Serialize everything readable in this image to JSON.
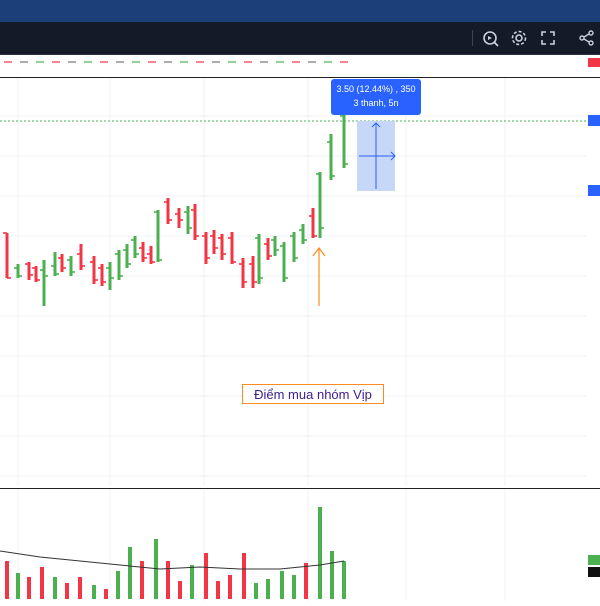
{
  "toolbar": {
    "icons": [
      "replay-icon",
      "gear-icon",
      "fullscreen-icon",
      "share-icon"
    ]
  },
  "chart_data": {
    "type": "candlestick",
    "price_bars_count": 57,
    "tooltip": {
      "line1": "3.50 (12.44%) , 350",
      "line2": "3 thanh, 5n"
    },
    "annotation": "Điểm mua nhóm Vịp",
    "colors": {
      "up": "#4caf50",
      "down": "#f23645",
      "ma_line": "#333333",
      "annotation_border": "#ff8a1f",
      "measure_box": "#c7d7f7",
      "tooltip_bg": "#2962ff"
    }
  }
}
